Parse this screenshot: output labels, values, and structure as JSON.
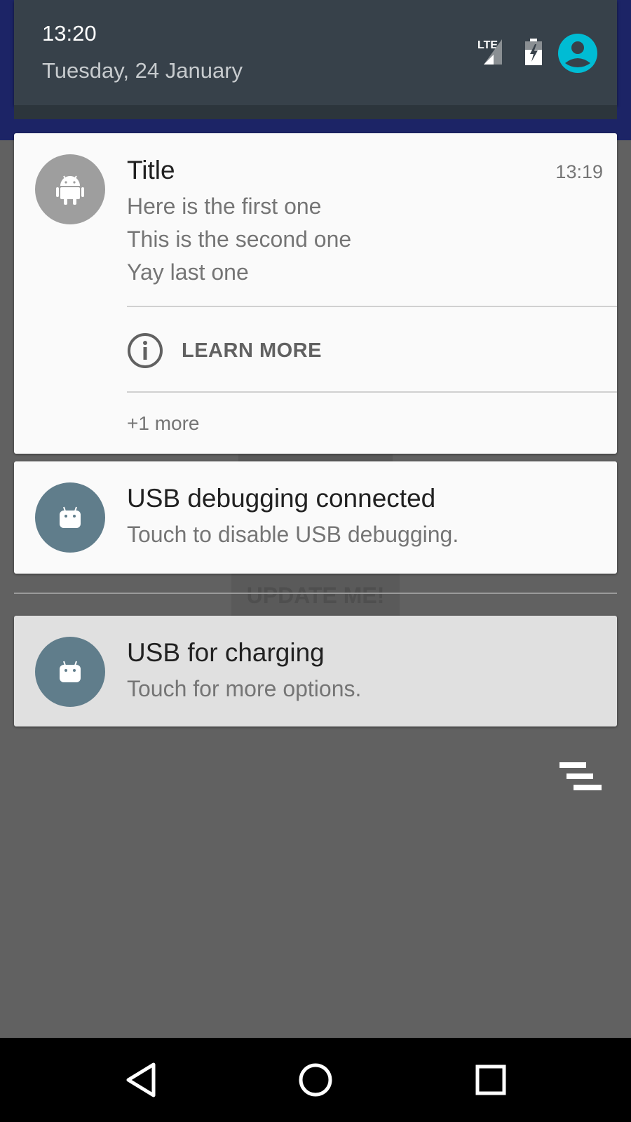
{
  "status": {
    "time": "13:20",
    "date": "Tuesday, 24 January",
    "network_label": "LTE"
  },
  "background": {
    "button_label": "UPDATE ME!"
  },
  "notifications": [
    {
      "title": "Title",
      "time": "13:19",
      "lines": [
        "Here is the first one",
        "This is the second one",
        "Yay last one"
      ],
      "action_label": "LEARN MORE",
      "more_label": "+1 more",
      "icon": "android-icon"
    },
    {
      "title": "USB debugging connected",
      "text": "Touch to disable USB debugging.",
      "icon": "android-head-icon"
    },
    {
      "title": "USB for charging",
      "text": "Touch for more options.",
      "icon": "android-head-icon"
    }
  ],
  "colors": {
    "accent": "#00bcd4",
    "status_bar": "#1c2466",
    "header": "#37414a",
    "shade": "#616161",
    "icon_bg_gray": "#9e9e9e",
    "icon_bg_bluegray": "#607d8b"
  }
}
